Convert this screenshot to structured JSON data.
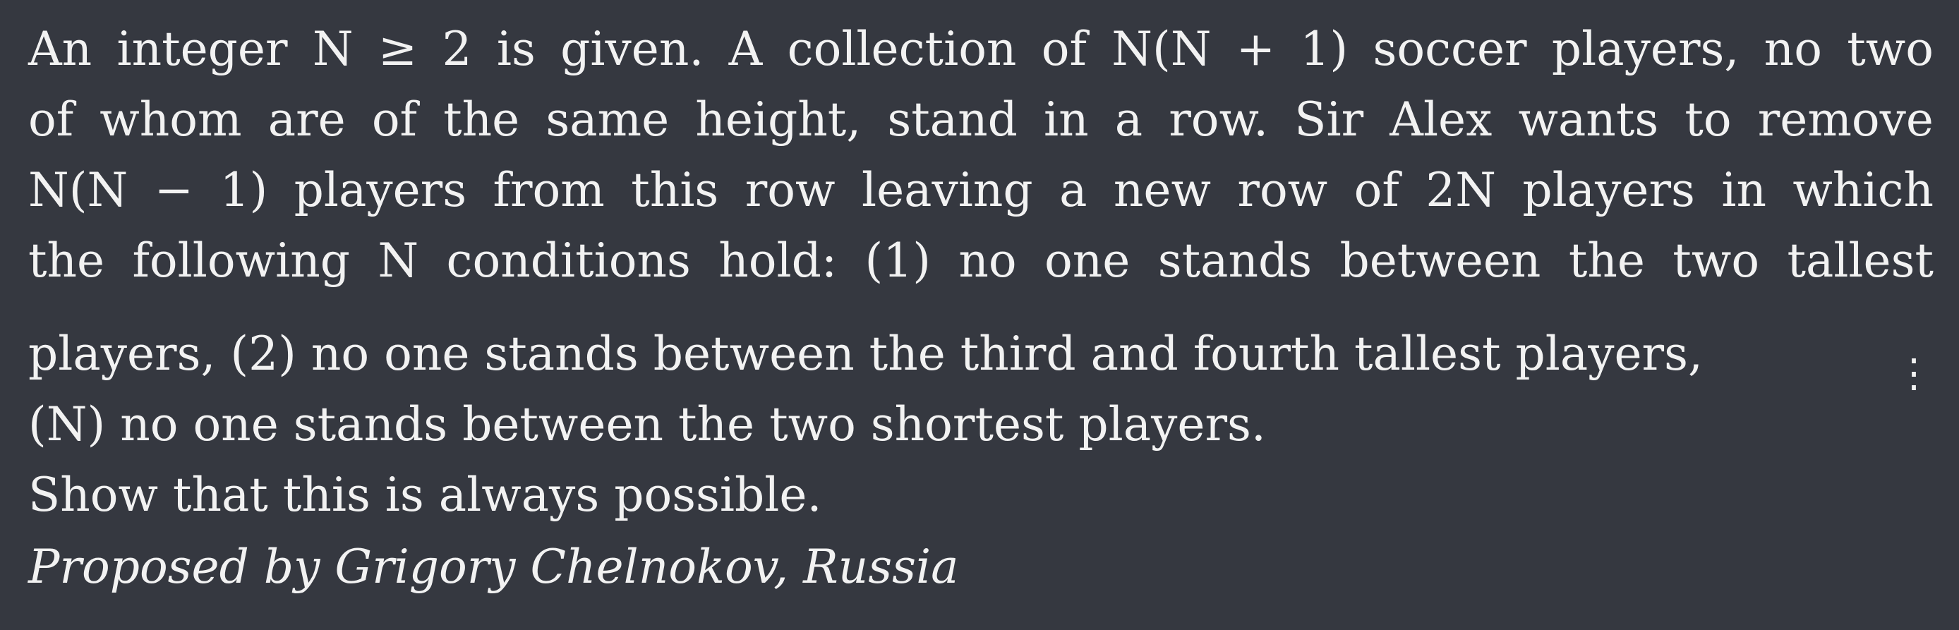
{
  "problem": {
    "line1": "An integer N ≥ 2 is given. A collection of N(N + 1) soccer players, no two",
    "line2": "of whom are of the same height, stand in a row. Sir Alex wants to remove",
    "line3": "N(N − 1) players from this row leaving a new row of 2N players in which",
    "line4": "the following N conditions hold: (1) no one stands between the two tallest",
    "line5": "players, (2) no one stands between the third and fourth tallest players,",
    "line5_vdots": "⋮",
    "line6": "(N) no one stands between the two shortest players.",
    "line7": "Show that this is always possible.",
    "attribution": "Proposed by Grigory Chelnokov, Russia"
  }
}
